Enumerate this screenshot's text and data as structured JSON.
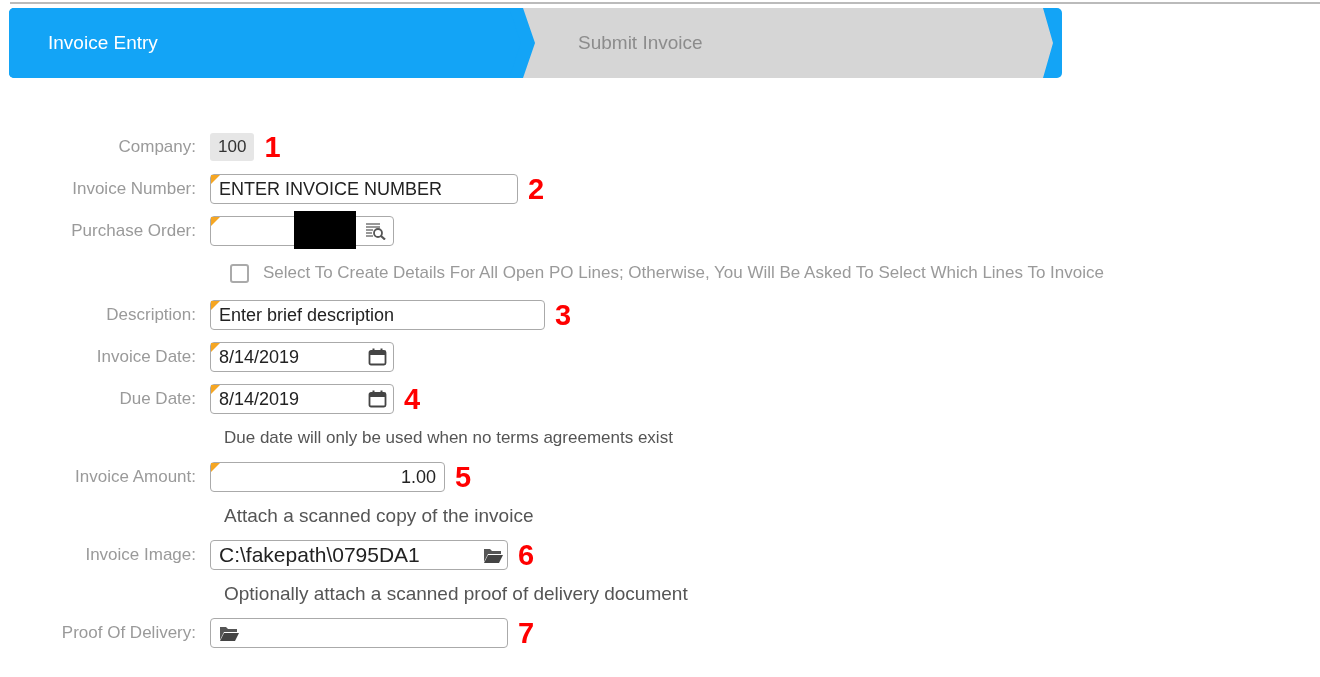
{
  "steps": [
    {
      "label": "Invoice Entry",
      "selected": true
    },
    {
      "label": "Submit Invoice",
      "selected": false
    }
  ],
  "form": [
    {
      "kind": "static",
      "label": "Company:",
      "value": "100",
      "callout": "1"
    },
    {
      "kind": "text",
      "label": "Invoice Number:",
      "value": "ENTER INVOICE NUMBER",
      "required": true,
      "callout": "2"
    },
    {
      "kind": "lookup",
      "label": "Purchase Order:",
      "required": true,
      "redacted": true
    },
    {
      "kind": "checkbox",
      "text": "Select To Create Details For All Open PO Lines; Otherwise, You Will Be Asked To Select Which Lines To Invoice",
      "checked": false
    },
    {
      "kind": "longtext",
      "label": "Description:",
      "value": "Enter brief description",
      "required": true,
      "callout": "3"
    },
    {
      "kind": "date",
      "label": "Invoice Date:",
      "value": "8/14/2019",
      "required": true
    },
    {
      "kind": "date",
      "label": "Due Date:",
      "value": "8/14/2019",
      "required": true,
      "callout": "4"
    },
    {
      "kind": "hint",
      "text": "Due date will only be used when no terms agreements exist"
    },
    {
      "kind": "amount",
      "label": "Invoice Amount:",
      "value": "1.00",
      "required": true,
      "callout": "5"
    },
    {
      "kind": "note",
      "text": "Attach a scanned copy of the invoice"
    },
    {
      "kind": "file",
      "label": "Invoice Image:",
      "value": "C:\\fakepath\\0795DA1",
      "callout": "6"
    },
    {
      "kind": "note",
      "text": "Optionally attach a scanned proof of delivery document"
    },
    {
      "kind": "file",
      "label": "Proof Of Delivery:",
      "callout": "7"
    }
  ]
}
